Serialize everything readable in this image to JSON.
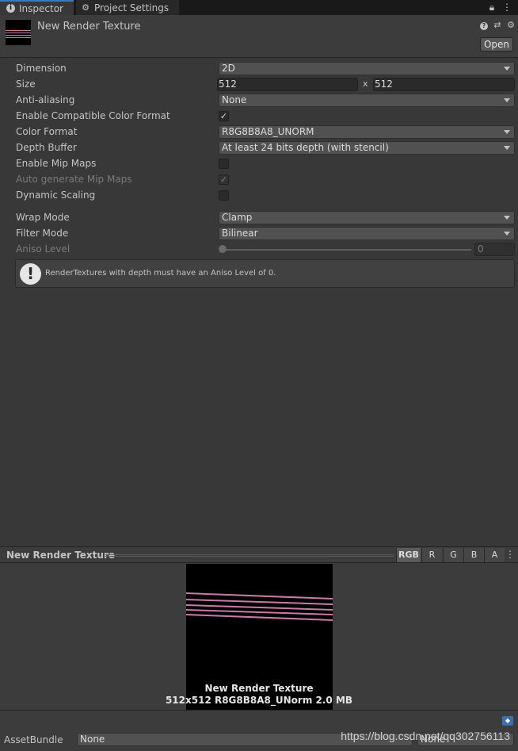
{
  "tabs": {
    "inspector": "Inspector",
    "project_settings": "Project Settings"
  },
  "header": {
    "title": "New Render Texture",
    "open_button": "Open"
  },
  "properties": {
    "dimension": {
      "label": "Dimension",
      "value": "2D"
    },
    "size": {
      "label": "Size",
      "width": "512",
      "separator": "x",
      "height": "512"
    },
    "anti_aliasing": {
      "label": "Anti-aliasing",
      "value": "None"
    },
    "compat_color": {
      "label": "Enable Compatible Color Format",
      "checked": true
    },
    "color_format": {
      "label": "Color Format",
      "value": "R8G8B8A8_UNORM"
    },
    "depth_buffer": {
      "label": "Depth Buffer",
      "value": "At least 24 bits depth (with stencil)"
    },
    "mip_maps": {
      "label": "Enable Mip Maps",
      "checked": false
    },
    "auto_mip": {
      "label": "Auto generate Mip Maps",
      "checked": true,
      "disabled": true
    },
    "dynamic_scaling": {
      "label": "Dynamic Scaling",
      "checked": false
    },
    "wrap_mode": {
      "label": "Wrap Mode",
      "value": "Clamp"
    },
    "filter_mode": {
      "label": "Filter Mode",
      "value": "Bilinear"
    },
    "aniso_level": {
      "label": "Aniso Level",
      "value": "0",
      "disabled": true
    }
  },
  "helpbox": {
    "message": "RenderTextures with depth must have an Aniso Level of 0."
  },
  "preview": {
    "title": "New Render Texture",
    "channels": [
      "RGB",
      "R",
      "G",
      "B",
      "A"
    ],
    "active_channel": "RGB",
    "name": "New Render Texture",
    "info": "512x512  R8G8B8A8_UNorm  2.0 MB"
  },
  "asset_bundle": {
    "label": "AssetBundle",
    "value": "None",
    "variant": "None"
  },
  "watermark": "https://blog.csdn.net/qq302756113",
  "colors": {
    "accent": "#3a79bb",
    "texture_lines": "#c87aa8"
  }
}
